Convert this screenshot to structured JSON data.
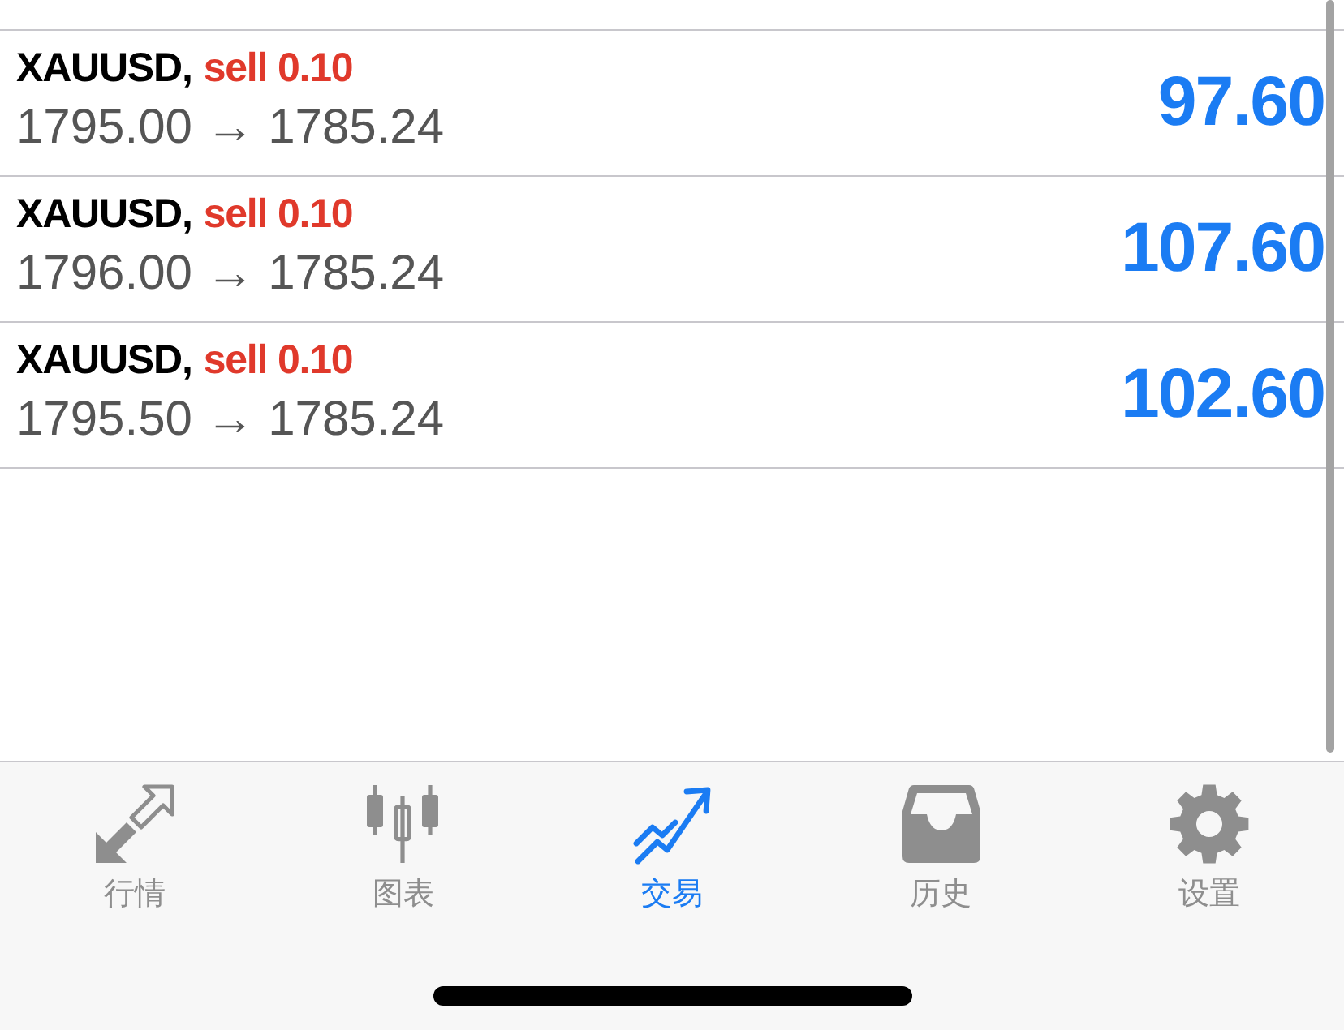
{
  "orders": [
    {
      "symbol": "XAUUSD,",
      "order": "sell 0.10",
      "prices": "1795.00 → 1785.24",
      "profit": "97.60"
    },
    {
      "symbol": "XAUUSD,",
      "order": "sell 0.10",
      "prices": "1796.00 → 1785.24",
      "profit": "107.60"
    },
    {
      "symbol": "XAUUSD,",
      "order": "sell 0.10",
      "prices": "1795.50 → 1785.24",
      "profit": "102.60"
    }
  ],
  "tab_bar": {
    "tabs": [
      {
        "label": "行情",
        "selected": false
      },
      {
        "label": "图表",
        "selected": false
      },
      {
        "label": "交易",
        "selected": true
      },
      {
        "label": "历史",
        "selected": false
      },
      {
        "label": "设置",
        "selected": false
      }
    ]
  }
}
